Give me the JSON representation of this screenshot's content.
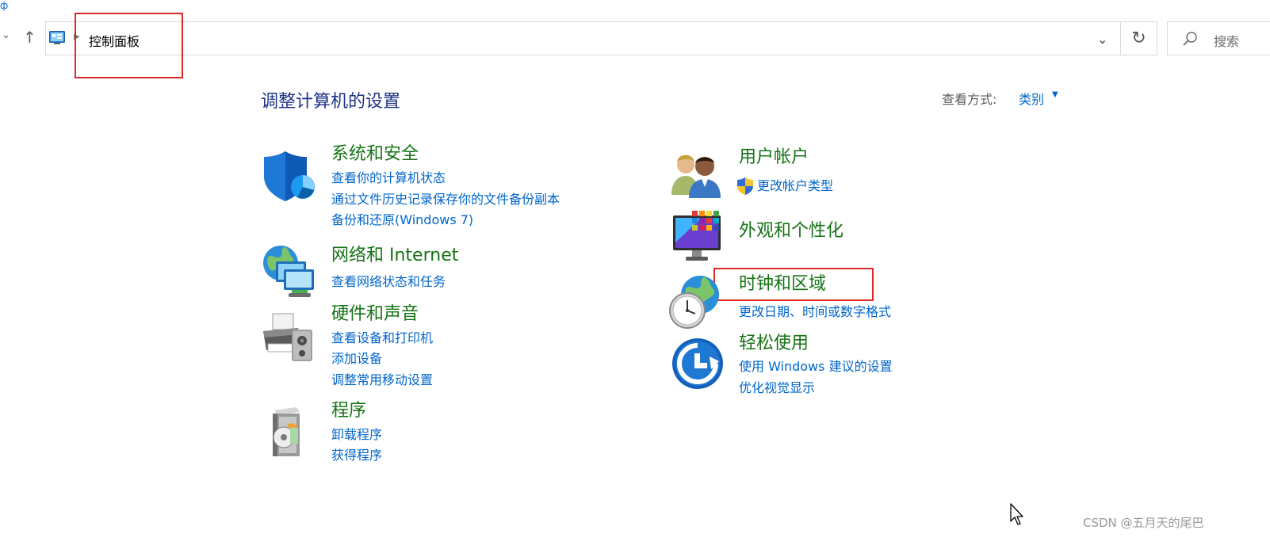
{
  "window": {
    "edge_glyph": "ф"
  },
  "navigation": {
    "address_path": "控制面板",
    "search_placeholder": "搜索"
  },
  "header": {
    "title": "调整计算机的设置",
    "view_by_label": "查看方式:",
    "view_by_value": "类别"
  },
  "categories": {
    "system_security": {
      "title": "系统和安全",
      "links": [
        "查看你的计算机状态",
        "通过文件历史记录保存你的文件备份副本",
        "备份和还原(Windows 7)"
      ]
    },
    "network": {
      "title": "网络和 Internet",
      "links": [
        "查看网络状态和任务"
      ]
    },
    "hardware": {
      "title": "硬件和声音",
      "links": [
        "查看设备和打印机",
        "添加设备",
        "调整常用移动设置"
      ]
    },
    "programs": {
      "title": "程序",
      "links": [
        "卸载程序",
        "获得程序"
      ]
    },
    "user_accounts": {
      "title": "用户帐户",
      "links": [
        "更改帐户类型"
      ]
    },
    "appearance": {
      "title": "外观和个性化",
      "links": []
    },
    "clock_region": {
      "title": "时钟和区域",
      "links": [
        "更改日期、时间或数字格式"
      ]
    },
    "ease_of_access": {
      "title": "轻松使用",
      "links": [
        "使用 Windows 建议的设置",
        "优化视觉显示"
      ]
    }
  },
  "watermark": "CSDN @五月天的尾巴",
  "colors": {
    "category_title": "#157315",
    "link": "#0066cc",
    "page_title": "#1e3287",
    "annotation": "#e02828"
  }
}
